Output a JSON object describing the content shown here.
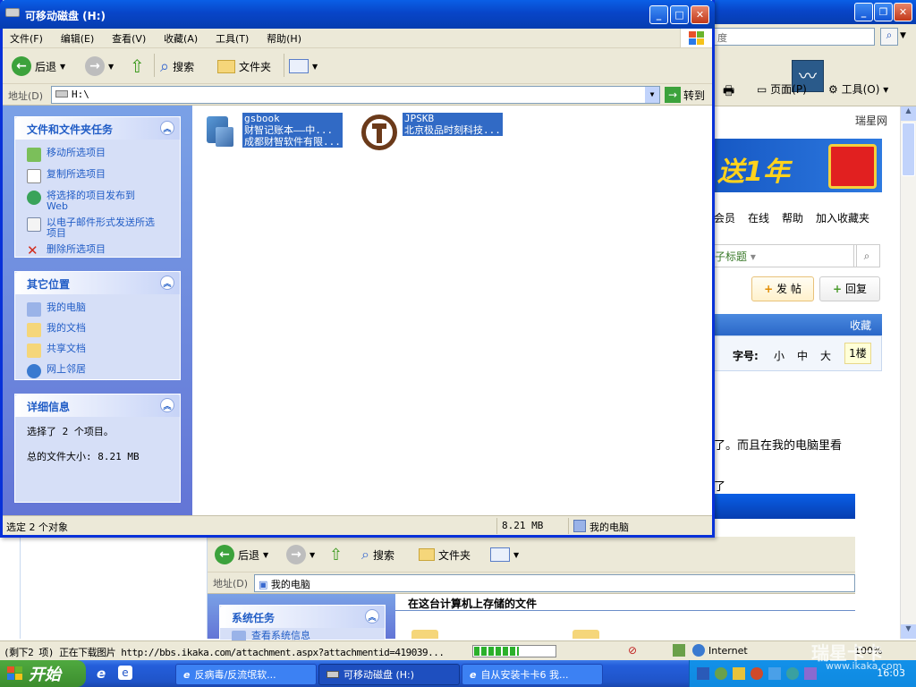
{
  "explorer": {
    "title": "可移动磁盘 (H:)",
    "menu": [
      "文件(F)",
      "编辑(E)",
      "查看(V)",
      "收藏(A)",
      "工具(T)",
      "帮助(H)"
    ],
    "toolbar": {
      "back": "后退",
      "search": "搜索",
      "folders": "文件夹"
    },
    "address_label": "地址(D)",
    "address_value": "H:\\",
    "go_label": "转到",
    "panels": {
      "file_tasks": {
        "title": "文件和文件夹任务",
        "items": [
          "移动所选项目",
          "复制所选项目",
          "将选择的项目发布到 Web",
          "以电子邮件形式发送所选项目",
          "删除所选项目"
        ]
      },
      "other_places": {
        "title": "其它位置",
        "items": [
          "我的电脑",
          "我的文档",
          "共享文档",
          "网上邻居"
        ]
      },
      "details": {
        "title": "详细信息",
        "line1": "选择了 2 个项目。",
        "line2": "总的文件大小: 8.21 MB"
      }
    },
    "files": [
      {
        "name": "gsbook",
        "desc1": "财智记账本——中...",
        "desc2": "成都财智软件有限...",
        "icon": "gsbook-icon"
      },
      {
        "name": "JPSKB",
        "desc1": "北京极品时刻科技...",
        "desc2": "",
        "icon": "railway-logo-icon"
      }
    ],
    "status": {
      "left": "选定 2 个对象",
      "size": "8.21 MB",
      "location": "我的电脑"
    }
  },
  "browser": {
    "search_placeholder": "度",
    "toolbar": {
      "page": "页面(P)",
      "tools": "工具(O)"
    },
    "site_name": "瑞星网",
    "banner_text": "送1年",
    "nav": [
      "会员",
      "在线",
      "帮助",
      "加入收藏夹"
    ],
    "search_hint": "子标题",
    "buttons": {
      "post": "发 帖",
      "reply": "回复"
    },
    "bar_label": "收藏",
    "font_label": "字号:",
    "font_sizes": [
      "小",
      "中",
      "大"
    ],
    "floor": "1楼",
    "body_line1": "了。而且在我的电脑里看",
    "body_line2": "了",
    "status_text": "(剩下2 项) 正在下载图片 http://bbs.ikaka.com/attachment.aspx?attachmentid=419039...",
    "zone": "Internet",
    "zoom": "100%",
    "progress": 0.55
  },
  "inner_window": {
    "toolbar": {
      "back": "后退",
      "search": "搜索",
      "folders": "文件夹"
    },
    "address_label": "地址(D)",
    "address_value": "我的电脑",
    "panel_title": "系统任务",
    "panel_item": "查看系统信息",
    "content_title": "在这台计算机上存储的文件"
  },
  "taskbar": {
    "start": "开始",
    "items": [
      "反病毒/反流氓软...",
      "可移动磁盘 (H:)",
      "自从安装卡卡6 我..."
    ],
    "time": "16:03",
    "watermark_line1": "瑞星卡卡",
    "watermark_line2": "www.ikaka.com"
  },
  "colors": {
    "xp_blue": "#0a5fe6",
    "selection": "#316ac5",
    "task_link": "#215dc6"
  }
}
